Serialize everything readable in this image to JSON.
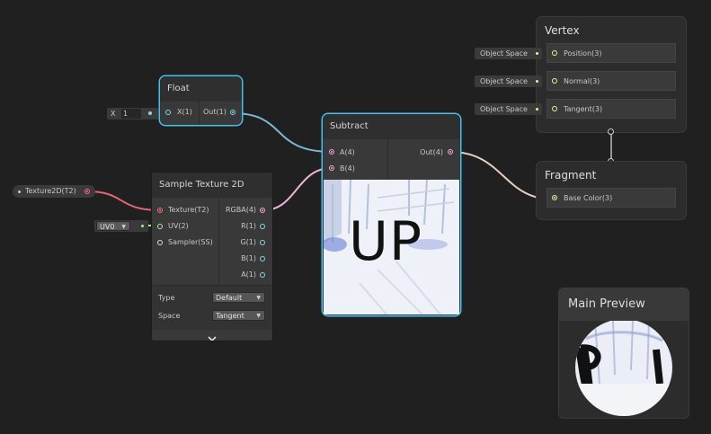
{
  "colors": {
    "selected_outline": "#44c0f0",
    "wire_texture": "#e06676",
    "wire_vector4": "#f0b4d6",
    "wire_float": "#8ad4f0",
    "wire_vector3": "#f0ef9c",
    "wire_vector2": "#9cf28a",
    "port_texture": "#ff6b7b",
    "port_vector4": "#f4a8d4",
    "port_float": "#7ad8f2",
    "port_vector3": "#f2f29c",
    "port_vector2": "#a4f29c"
  },
  "float_node": {
    "title": "Float",
    "input_label": "X(1)",
    "output_label": "Out(1)",
    "field_axis": "X",
    "field_value": "1"
  },
  "texture_property": {
    "label": "Texture2D(T2)"
  },
  "uv_field": {
    "value": "UV0"
  },
  "sample_texture_node": {
    "title": "Sample Texture 2D",
    "inputs": [
      "Texture(T2)",
      "UV(2)",
      "Sampler(SS)"
    ],
    "outputs": [
      "RGBA(4)",
      "R(1)",
      "G(1)",
      "B(1)",
      "A(1)"
    ],
    "type_label": "Type",
    "type_value": "Default",
    "space_label": "Space",
    "space_value": "Tangent"
  },
  "subtract_node": {
    "title": "Subtract",
    "inputs": [
      "A(4)",
      "B(4)"
    ],
    "output_label": "Out(4)",
    "preview_text": "UP"
  },
  "vertex_block": {
    "title": "Vertex",
    "slots": [
      "Position(3)",
      "Normal(3)",
      "Tangent(3)"
    ],
    "space_fields": [
      "Object Space",
      "Object Space",
      "Object Space"
    ]
  },
  "fragment_block": {
    "title": "Fragment",
    "slots": [
      "Base Color(3)"
    ]
  },
  "main_preview": {
    "title": "Main Preview"
  }
}
